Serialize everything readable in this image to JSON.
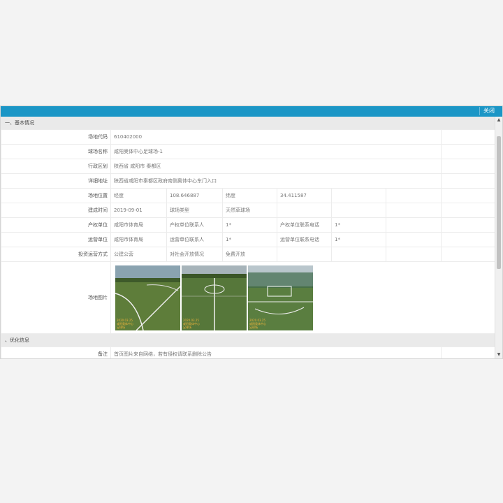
{
  "dialog": {
    "close_label": "关闭",
    "header_color": "#1b96c6"
  },
  "section1": {
    "title": "一、基本情况"
  },
  "basic": {
    "code_label": "场地代码",
    "code_value": "610402000",
    "name_label": "球场名称",
    "name_value": "咸阳奥体中心足球场-1",
    "region_label": "行政区划",
    "region_value": "陕西省 咸阳市 秦都区",
    "address_label": "详细地址",
    "address_value": "陕西省咸阳市秦都区政府南侧奥体中心东门入口"
  },
  "location": {
    "pos_label": "场地位置",
    "lng_label": "经度",
    "lng_value": "108.646887",
    "lat_label": "纬度",
    "lat_value": "34.411587",
    "built_label": "建成时间",
    "built_value": "2019-09-01",
    "type_label": "球场类型",
    "type_value": "天然草球场",
    "owner_label": "产权单位",
    "owner_value": "咸阳市体育局",
    "owner_contact_label": "产权单位联系人",
    "owner_contact_value": "1*",
    "owner_phone_label": "产权单位联系电话",
    "owner_phone_value": "1*"
  },
  "operation": {
    "op_label": "运营单位",
    "op_value": "咸阳市体育局",
    "op_contact_label": "运营单位联系人",
    "op_contact_value": "1*",
    "op_phone_label": "运营单位联系电话",
    "op_phone_value": "1*",
    "mode_label": "投资运营方式",
    "mode_value": "公建公营",
    "open_label": "对社会开放情况",
    "open_value": "免费开放"
  },
  "photos": {
    "label": "场地图片",
    "captions": [
      "2020.03.25\n咸阳奥体中心\n足球场",
      "2020.03.25\n咸阳奥体中心\n足球场",
      "2020.03.25\n咸阳奥体中心\n足球场"
    ]
  },
  "section2": {
    "title": "、优化信息"
  },
  "remark": {
    "label": "备注",
    "value": "首页图片来自网络，若有侵权请联系删除公告"
  }
}
